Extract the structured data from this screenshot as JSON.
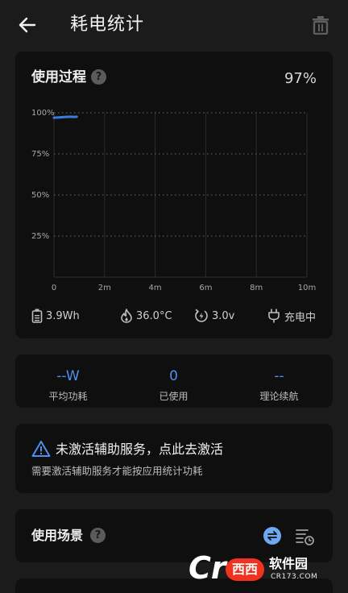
{
  "header": {
    "title": "耗电统计",
    "back_icon": "arrow-left-icon",
    "delete_icon": "trash-icon"
  },
  "usage": {
    "title": "使用过程",
    "percent": "97%",
    "help_icon": "question-icon",
    "stats": {
      "capacity": "3.9Wh",
      "temperature": "36.0°C",
      "voltage": "3.0v",
      "charge_state": "充电中"
    }
  },
  "chart_data": {
    "type": "line",
    "y_tick_labels": [
      "100%",
      "75%",
      "50%",
      "25%"
    ],
    "x_tick_labels": [
      "0",
      "2m",
      "4m",
      "6m",
      "8m",
      "10m"
    ],
    "xlim": [
      0,
      10
    ],
    "ylim": [
      0,
      100
    ],
    "series": [
      {
        "color": "#3a7be0",
        "x": [
          0,
          0.2,
          0.4,
          0.6,
          0.8,
          0.9
        ],
        "y": [
          97,
          97.2,
          97.4,
          97.6,
          97.5,
          97.6
        ]
      }
    ],
    "grid": true
  },
  "summary": {
    "items": [
      {
        "value": "--W",
        "label": "平均功耗"
      },
      {
        "value": "0",
        "label": "已使用"
      },
      {
        "value": "--",
        "label": "理论续航"
      }
    ]
  },
  "accessibility_notice": {
    "title": "未激活辅助服务，点此去激活",
    "description": "需要激活辅助服务才能按应用统计功耗",
    "icon": "warning-icon"
  },
  "scenes": {
    "title": "使用场景",
    "help_icon": "question-icon",
    "swap_icon": "swap-icon",
    "sort_icon": "sort-list-icon"
  },
  "watermark": {
    "logo_letter": "Cr",
    "badge": "西西",
    "name": "软件园",
    "url": "CR173.COM"
  },
  "colors": {
    "background": "#1b1b1b",
    "card": "#0f0f0f",
    "accent": "#4f8ff0"
  }
}
